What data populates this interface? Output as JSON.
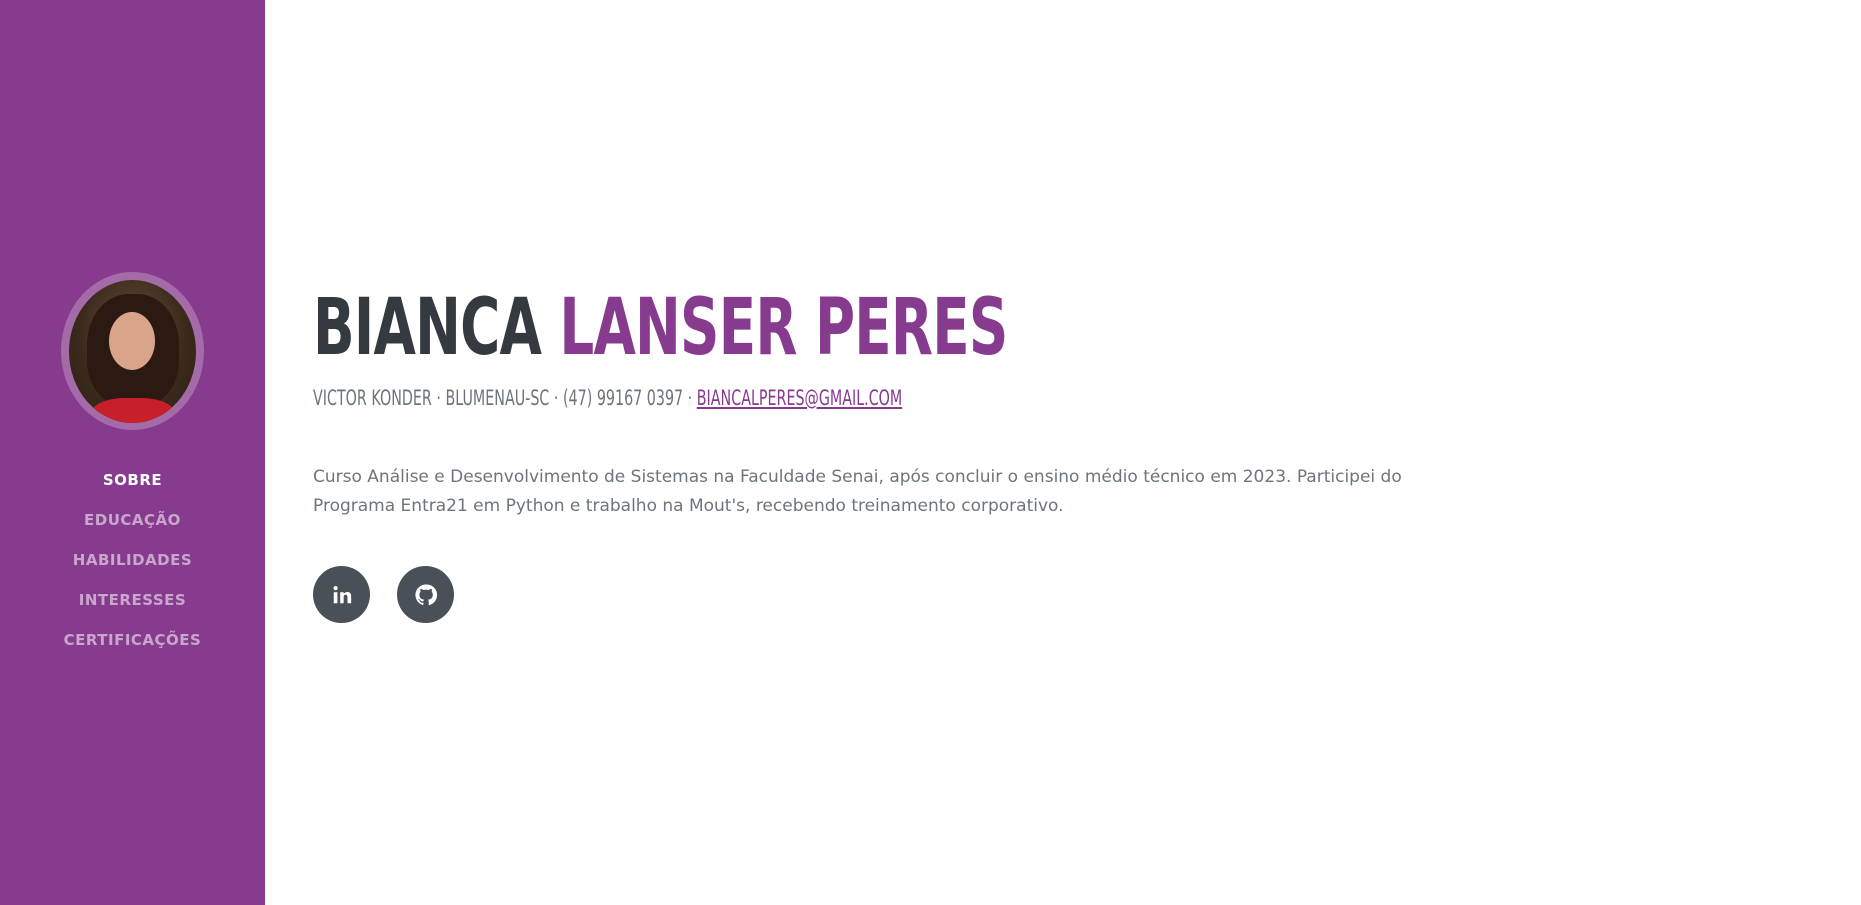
{
  "sidebar": {
    "avatar_alt": "Bianca Lanser Peres",
    "accent_color": "#873b8e",
    "nav": [
      {
        "label": "SOBRE",
        "active": true
      },
      {
        "label": "EDUCAÇÃO",
        "active": false
      },
      {
        "label": "HABILIDADES",
        "active": false
      },
      {
        "label": "INTERESSES",
        "active": false
      },
      {
        "label": "CERTIFICAÇÕES",
        "active": false
      }
    ]
  },
  "about": {
    "first_name": "BIANCA",
    "last_name": "LANSER PERES",
    "address": "VICTOR KONDER · BLUMENAU-SC · (47) 99167 0397 · ",
    "email": "BIANCALPERES@GMAIL.COM",
    "description": "Curso Análise e Desenvolvimento de Sistemas na Faculdade Senai, após concluir o ensino médio técnico em 2023. Participei do Programa Entra21 em Python e trabalho na Mout's, recebendo treinamento corporativo.",
    "social": [
      {
        "icon": "linkedin-icon"
      },
      {
        "icon": "github-icon"
      }
    ]
  }
}
